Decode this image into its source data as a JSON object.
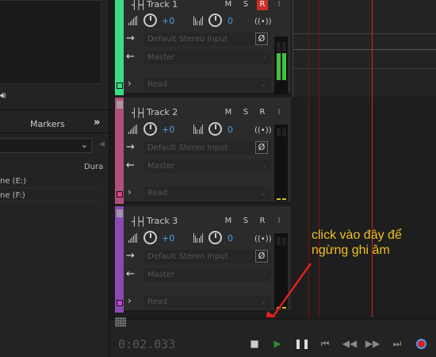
{
  "left_panel": {
    "speaker_icon": "speaker-icon",
    "tab_label": "Markers",
    "column_header": "Dura",
    "rows": [
      "ne (E:)",
      "ne (F:)"
    ]
  },
  "tracks": [
    {
      "name": "Track 1",
      "mute": "M",
      "solo": "S",
      "record": "R",
      "input": "I",
      "volume": "+0",
      "pan": "0",
      "input_device": "Default Stereo Input",
      "output": "Master",
      "automation": "Read",
      "color": "#3ddc84",
      "record_armed": true
    },
    {
      "name": "Track 2",
      "mute": "M",
      "solo": "S",
      "record": "R",
      "input": "I",
      "volume": "+0",
      "pan": "0",
      "input_device": "Default Stereo Input",
      "output": "Master",
      "automation": "Read",
      "color": "#b0507a",
      "record_armed": false
    },
    {
      "name": "Track 3",
      "mute": "M",
      "solo": "S",
      "record": "R",
      "input": "I",
      "volume": "+0",
      "pan": "0",
      "input_device": "Default Stereo Input",
      "output": "Master",
      "automation": "Read",
      "color": "#8a4ab0",
      "record_armed": false
    }
  ],
  "transport": {
    "time": "0:02.033",
    "buttons": [
      "stop",
      "play",
      "pause",
      "go-to-start",
      "rewind",
      "fast-forward",
      "go-to-end",
      "record"
    ]
  },
  "annotation": {
    "line1": "click vào đây để",
    "line2": "ngừng ghi âm",
    "color": "#f0c020"
  },
  "colors": {
    "record_active": "#c8302a",
    "playhead": "#d42020",
    "value_blue": "#4d9de0"
  }
}
